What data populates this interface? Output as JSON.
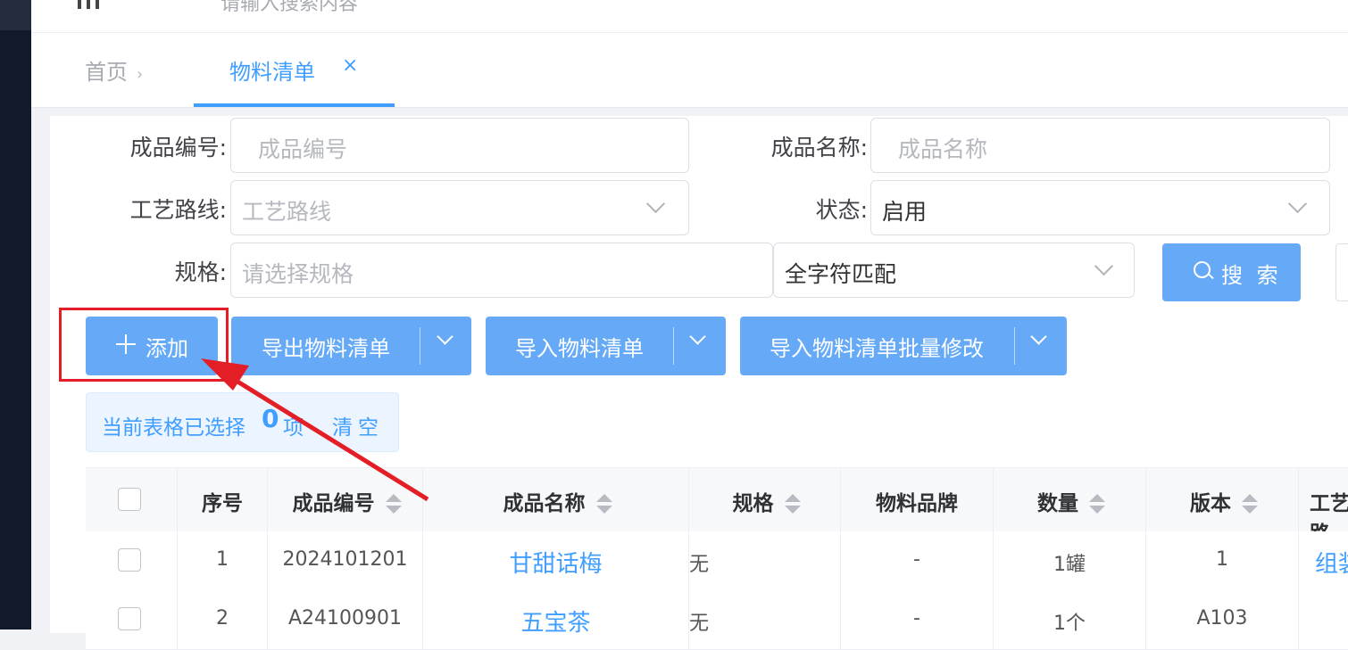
{
  "header": {
    "search_placeholder": "请输入搜索内容"
  },
  "tabs": {
    "home": "首页",
    "active": "物料清单",
    "close_glyph": "×",
    "separator": "›"
  },
  "filters": {
    "product_code_label": "成品编号:",
    "product_code_placeholder": "成品编号",
    "product_name_label": "成品名称:",
    "product_name_placeholder": "成品名称",
    "route_label": "工艺路线:",
    "route_placeholder": "工艺路线",
    "status_label": "状态:",
    "status_value": "启用",
    "spec_label": "规格:",
    "spec_placeholder": "请选择规格",
    "match_value": "全字符匹配",
    "search_button": "搜 索"
  },
  "toolbar": {
    "add": "添加",
    "export": "导出物料清单",
    "import": "导入物料清单",
    "import_batch": "导入物料清单批量修改"
  },
  "selection": {
    "prefix": "当前表格已选择",
    "count": "0",
    "suffix": "项",
    "clear": "清空"
  },
  "table": {
    "columns": [
      "序号",
      "成品编号",
      "成品名称",
      "规格",
      "物料品牌",
      "数量",
      "版本",
      "工艺路"
    ],
    "rows": [
      {
        "index": "1",
        "code": "2024101201",
        "name": "甘甜话梅",
        "spec": "无",
        "brand": "-",
        "qty": "1罐",
        "version": "1",
        "route": "组装"
      },
      {
        "index": "2",
        "code": "A24100901",
        "name": "五宝茶",
        "spec": "无",
        "brand": "-",
        "qty": "1个",
        "version": "A103",
        "route": ""
      }
    ]
  },
  "colors": {
    "primary": "#409eff",
    "button": "#66aaf7",
    "highlight": "#e41e26",
    "sidebar": "#101a2b"
  }
}
